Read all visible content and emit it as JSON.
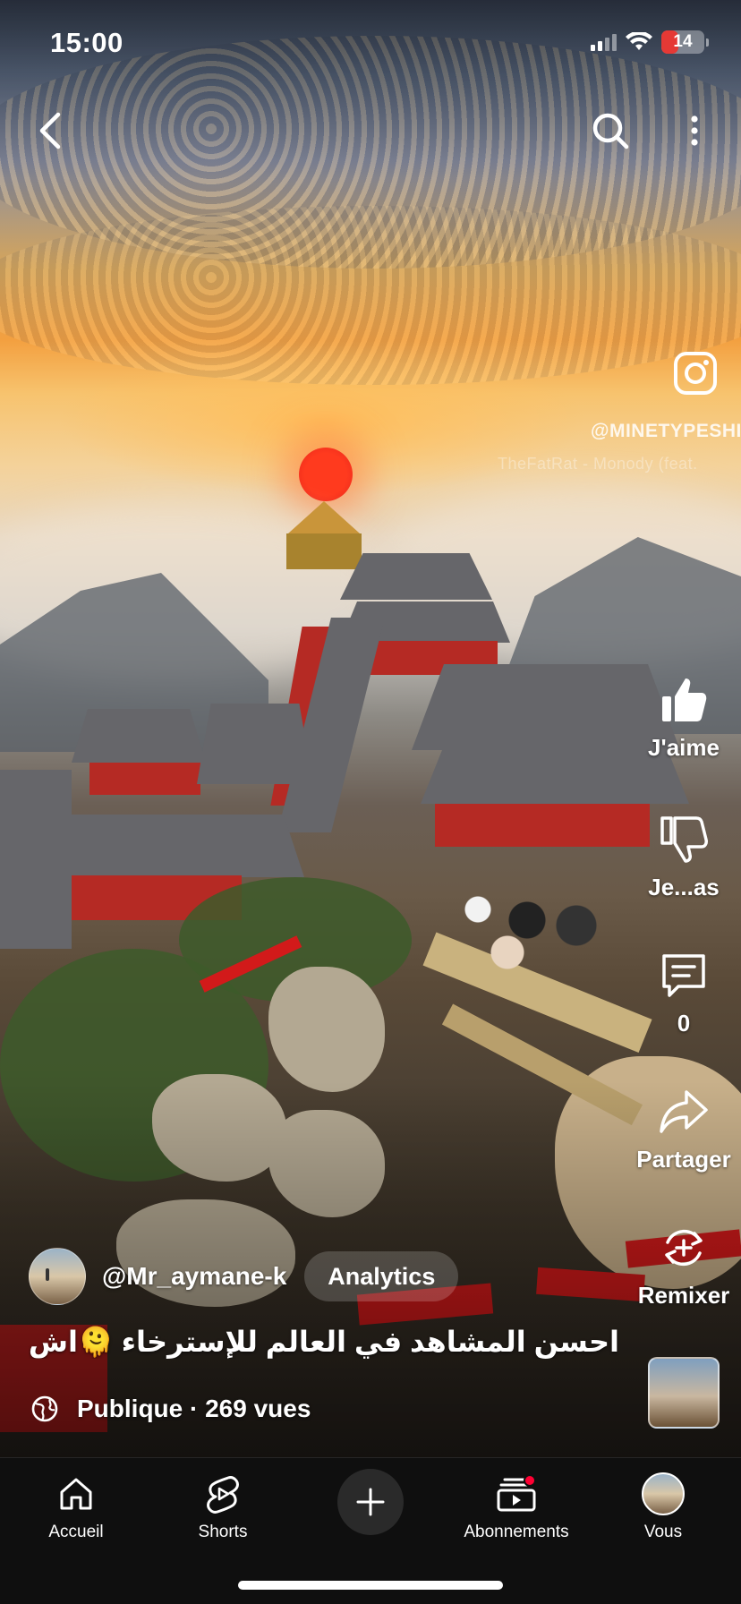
{
  "status_bar": {
    "time": "15:00",
    "battery_level": "14",
    "battery_color": "#e53935"
  },
  "top_bar": {
    "back_icon": "chevron-left-icon",
    "search_icon": "search-icon",
    "more_icon": "more-vertical-icon"
  },
  "watermark": {
    "icon": "instagram-icon",
    "handle": "@MINETYPESHI",
    "music_credit": "TheFatRat - Monody (feat."
  },
  "actions": {
    "like_label": "J'aime",
    "dislike_label": "Je...as",
    "comment_count": "0",
    "share_label": "Partager",
    "remix_label": "Remixer"
  },
  "channel": {
    "name": "@Mr_aymane-k",
    "analytics_label": "Analytics"
  },
  "video": {
    "title": "احسن المشاهد في العالم للإسترخاء 🫠اش...",
    "visibility": "Publique · 269 vues"
  },
  "bottom_nav": {
    "items": [
      {
        "label": "Accueil",
        "icon": "home-icon"
      },
      {
        "label": "Shorts",
        "icon": "shorts-icon"
      },
      {
        "label": "",
        "icon": "plus-icon"
      },
      {
        "label": "Abonnements",
        "icon": "subscriptions-icon"
      },
      {
        "label": "Vous",
        "icon": "avatar"
      }
    ],
    "notification_color": "#ff0033"
  }
}
